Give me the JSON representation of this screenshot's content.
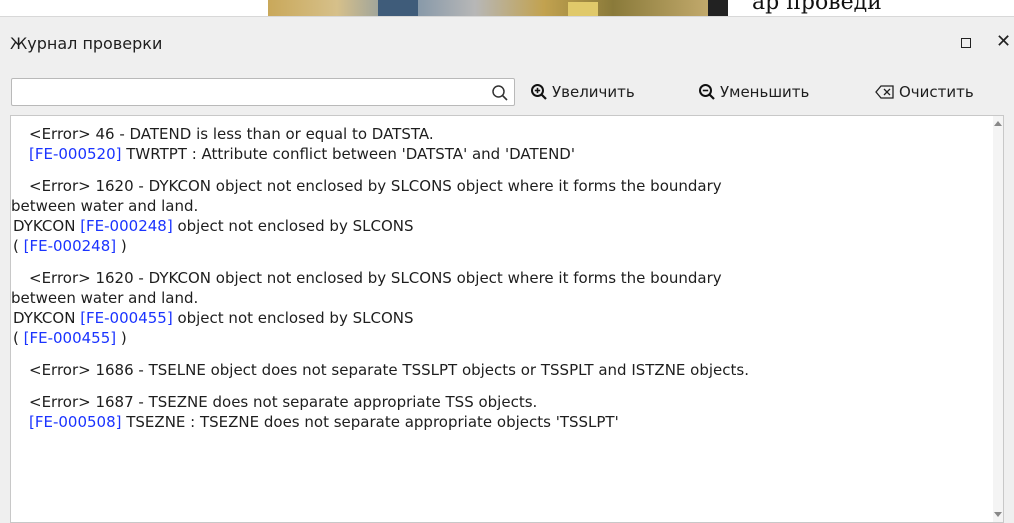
{
  "background": {
    "partial_text": "ар  проведи"
  },
  "panel": {
    "title": "Журнал проверки"
  },
  "toolbar": {
    "search_value": "",
    "search_placeholder": "",
    "zoom_in_label": "Увеличить",
    "zoom_out_label": "Уменьшить",
    "clear_label": "Очистить"
  },
  "log": {
    "entries": [
      {
        "error": "<Error> 46 - DATEND is less than or equal to DATSTA.",
        "link": "[FE-000520]",
        "detail": " TWRTPT : Attribute conflict between 'DATSTA' and 'DATEND'"
      },
      {
        "error_line1": "<Error> 1620 - DYKCON object not enclosed by SLCONS object where it forms the boundary",
        "error_line2": "between water and land.",
        "prefix": "DYKCON ",
        "link": "[FE-000248]",
        "detail": " object not enclosed by SLCONS",
        "paren_open": "( ",
        "paren_link": "[FE-000248]",
        "paren_close": " )"
      },
      {
        "error_line1": "<Error> 1620 - DYKCON object not enclosed by SLCONS object where it forms the boundary",
        "error_line2": "between water and land.",
        "prefix": "DYKCON ",
        "link": "[FE-000455]",
        "detail": " object not enclosed by SLCONS",
        "paren_open": "( ",
        "paren_link": "[FE-000455]",
        "paren_close": " )"
      },
      {
        "error": "<Error> 1686 - TSELNE object does not separate TSSLPT objects or TSSPLT and ISTZNE objects."
      },
      {
        "error": "<Error> 1687 - TSEZNE does not separate appropriate TSS objects.",
        "link": "[FE-000508]",
        "detail": " TSEZNE : TSEZNE does not separate appropriate objects 'TSSLPT'"
      }
    ]
  },
  "colors": {
    "link": "#1a33ff",
    "panel_bg": "#efefef"
  }
}
